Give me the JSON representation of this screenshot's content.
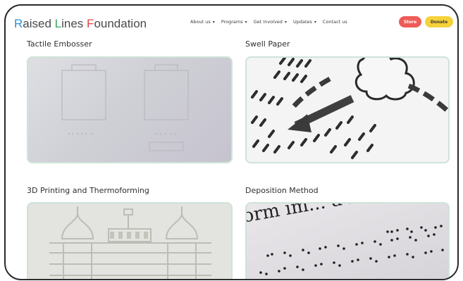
{
  "header": {
    "logo": {
      "part1": "R",
      "part2": "aised ",
      "part3": "L",
      "part4": "ines ",
      "part5": "F",
      "part6": "oundation"
    },
    "nav": [
      {
        "label": "About us",
        "has_dropdown": true
      },
      {
        "label": "Programs",
        "has_dropdown": true
      },
      {
        "label": "Get Involved",
        "has_dropdown": true
      },
      {
        "label": "Updates",
        "has_dropdown": true
      },
      {
        "label": "Contact us",
        "has_dropdown": false
      }
    ],
    "store_label": "Store",
    "donate_label": "Donate",
    "colors": {
      "store": "#ef5b57",
      "donate": "#f6d23a",
      "logo_blue": "#2f8fd8",
      "logo_green": "#3aa35f",
      "logo_red": "#e0473f"
    }
  },
  "cards": [
    {
      "title": "Tactile Embosser"
    },
    {
      "title": "Swell Paper"
    },
    {
      "title": "3D Printing and Thermoforming"
    },
    {
      "title": "Deposition Method",
      "image_text": "orm im... a new world of"
    }
  ]
}
